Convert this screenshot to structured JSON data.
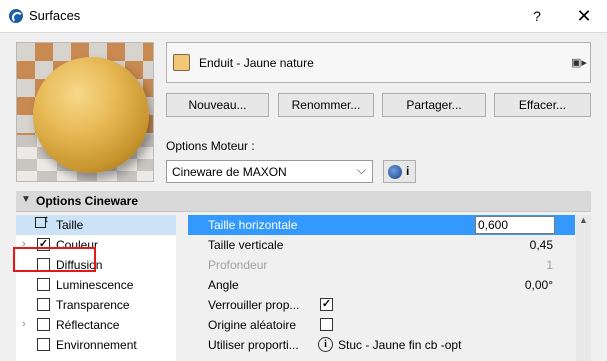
{
  "window": {
    "title": "Surfaces",
    "help": "?",
    "close": "✕"
  },
  "surface": {
    "name": "Enduit - Jaune nature",
    "swatch_color": "#f4c678"
  },
  "buttons": {
    "new": "Nouveau...",
    "rename": "Renommer...",
    "share": "Partager...",
    "delete": "Effacer..."
  },
  "engine": {
    "label": "Options Moteur :",
    "selected": "Cineware de MAXON",
    "info": "i"
  },
  "section": {
    "title": "Options Cineware"
  },
  "tree": {
    "items": [
      {
        "label": "Taille",
        "checked": null,
        "expandable": false,
        "selected": true
      },
      {
        "label": "Couleur",
        "checked": true,
        "expandable": true
      },
      {
        "label": "Diffusion",
        "checked": false,
        "expandable": false
      },
      {
        "label": "Luminescence",
        "checked": false,
        "expandable": false
      },
      {
        "label": "Transparence",
        "checked": false,
        "expandable": false
      },
      {
        "label": "Réflectance",
        "checked": false,
        "expandable": true
      },
      {
        "label": "Environnement",
        "checked": false,
        "expandable": false
      }
    ]
  },
  "properties": {
    "rows": [
      {
        "name": "Taille horizontale",
        "value": "0,600"
      },
      {
        "name": "Taille verticale",
        "value": "0,45"
      },
      {
        "name": "Profondeur",
        "value": "1"
      },
      {
        "name": "Angle",
        "value": "0,00°"
      },
      {
        "name": "Verrouiller prop...",
        "checked": true
      },
      {
        "name": "Origine aléatoire",
        "checked": false
      },
      {
        "name": "Utiliser proporti...",
        "value": "Stuc - Jaune fin cb -opt"
      }
    ]
  },
  "colors": {
    "accent": "#3399ff",
    "highlight": "#e0191b"
  }
}
